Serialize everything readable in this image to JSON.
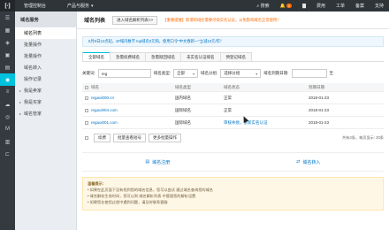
{
  "topbar": {
    "console": "管理控制台",
    "products": "产品与服务",
    "search": "搜索",
    "bell_count": "1",
    "fees": "费用",
    "ticket": "工单",
    "record": "备案",
    "support": "支持"
  },
  "sidebar": {
    "title": "域名服务",
    "items": [
      "域名列表",
      "批量操作",
      "批量操作",
      "域名转入",
      "操作记录",
      "我是卖家",
      "我是买家",
      "域名管家"
    ]
  },
  "main": {
    "title": "域名列表",
    "head_button": "进入域名解析列表>>",
    "warning": "【重要提醒】新增的域名需要尽快实名认证，以免影响域名正常使用！",
    "notice": "5月8日12点起，4#域内数字.top域名0元购，使用口令\"中文春新一\"立减10元/年！"
  },
  "tabs": [
    "全部域名",
    "急需续费域名",
    "急需赎回域名",
    "未实名认证域名",
    "预登记域名"
  ],
  "filters": {
    "keyword_label": "关键词:",
    "keyword_value": "reg",
    "type_label": "域名类型:",
    "type_value": "全部",
    "group_label": "域名分组:",
    "group_value": "选择分组",
    "date_label": "域名到期日期:",
    "to_label": "至"
  },
  "table": {
    "headers": [
      "域名",
      "域名类型",
      "域名状态",
      "到期日期"
    ],
    "rows": [
      {
        "domain": "regaoi000.cn",
        "type": "国内域名",
        "status": "正常",
        "expiry": "2018-01-23"
      },
      {
        "domain": "regaoi004.com",
        "type": "国际域名",
        "status": "正常",
        "expiry": "2018-01-23"
      },
      {
        "domain": "regaoi001.com",
        "type": "国际域名",
        "status": "审核失败，重新实名认证",
        "expiry": "2018-01-23"
      }
    ]
  },
  "bulk": {
    "renew": "续费",
    "batch": "批量查看短号",
    "more": "更多批量操作",
    "pager": "共有3条，每页显示: 20条"
  },
  "actions": [
    "域名注册",
    "域名转入"
  ],
  "tips": {
    "title": "温馨提示：",
    "lines": [
      "• 如果在此页面下没有找到您的域名信息，您可以尝试 通过域名查询您的域名",
      "• 域名解析生效时间，您可以到 域名解析列表 中管理您的解析设置",
      "• 如果您在使用过程中遇到问题，请及时联系客服"
    ]
  }
}
